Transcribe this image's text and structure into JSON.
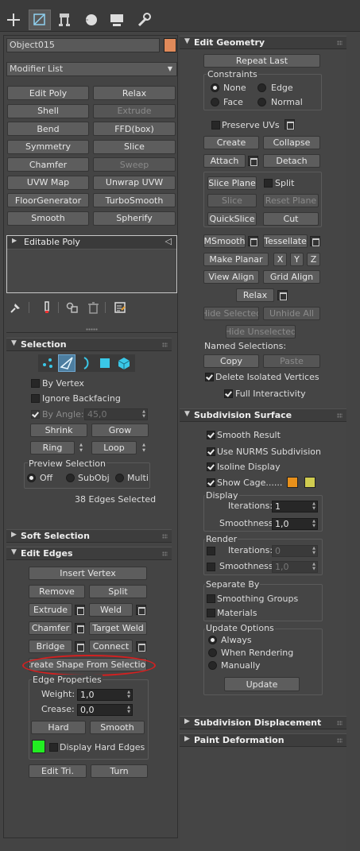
{
  "tabs": [
    {
      "name": "create-tab-icon"
    },
    {
      "name": "modify-tab-icon"
    },
    {
      "name": "hierarchy-tab-icon"
    },
    {
      "name": "motion-tab-icon"
    },
    {
      "name": "display-tab-icon"
    },
    {
      "name": "utilities-tab-icon"
    }
  ],
  "object_name": "Object015",
  "object_color": "#e08a5a",
  "modifier_list": "Modifier List",
  "modifier_buttons": [
    "Edit Poly",
    "Relax",
    "Shell",
    "Extrude",
    "Bend",
    "FFD(box)",
    "Symmetry",
    "Slice",
    "Chamfer",
    "Sweep",
    "UVW Map",
    "Unwrap UVW",
    "FloorGenerator",
    "TurboSmooth",
    "Smooth",
    "Spherify"
  ],
  "stack_item": "Editable Poly",
  "selection": {
    "title": "Selection",
    "by_vertex": "By Vertex",
    "ignore_backfacing": "Ignore Backfacing",
    "by_angle": "By Angle:",
    "angle_value": "45,0",
    "shrink": "Shrink",
    "grow": "Grow",
    "ring": "Ring",
    "loop": "Loop",
    "preview_title": "Preview Selection",
    "preview_off": "Off",
    "preview_subobj": "SubObj",
    "preview_multi": "Multi",
    "status": "38 Edges Selected"
  },
  "soft_selection": {
    "title": "Soft Selection"
  },
  "edit_edges": {
    "title": "Edit Edges",
    "insert_vertex": "Insert Vertex",
    "remove": "Remove",
    "split": "Split",
    "extrude": "Extrude",
    "weld": "Weld",
    "chamfer": "Chamfer",
    "target_weld": "Target Weld",
    "bridge": "Bridge",
    "connect": "Connect",
    "create_shape": "Create Shape From Selection",
    "edge_props": "Edge Properties",
    "weight_label": "Weight:",
    "weight_value": "1,0",
    "crease_label": "Crease:",
    "crease_value": "0,0",
    "hard": "Hard",
    "smooth": "Smooth",
    "hard_edge_color": "#22ee22",
    "display_hard_edges": "Display Hard Edges",
    "edit_tri": "Edit Tri.",
    "turn": "Turn"
  },
  "edit_geometry": {
    "title": "Edit Geometry",
    "repeat_last": "Repeat Last",
    "constraints": "Constraints",
    "none": "None",
    "edge": "Edge",
    "face": "Face",
    "normal": "Normal",
    "preserve_uvs": "Preserve UVs",
    "create": "Create",
    "collapse": "Collapse",
    "attach": "Attach",
    "detach": "Detach",
    "slice_plane": "Slice Plane",
    "split": "Split",
    "slice": "Slice",
    "reset_plane": "Reset Plane",
    "quickslice": "QuickSlice",
    "cut": "Cut",
    "msmooth": "MSmooth",
    "tessellate": "Tessellate",
    "make_planar": "Make Planar",
    "x": "X",
    "y": "Y",
    "z": "Z",
    "view_align": "View Align",
    "grid_align": "Grid Align",
    "relax": "Relax",
    "hide_selected": "Hide Selected",
    "unhide_all": "Unhide All",
    "hide_unselected": "Hide Unselected",
    "named_selections": "Named Selections:",
    "copy": "Copy",
    "paste": "Paste",
    "delete_isolated": "Delete Isolated Vertices",
    "full_interactivity": "Full Interactivity"
  },
  "subdivision_surface": {
    "title": "Subdivision Surface",
    "smooth_result": "Smooth Result",
    "use_nurms": "Use NURMS Subdivision",
    "isoline": "Isoline Display",
    "show_cage": "Show Cage......",
    "cage_color1": "#e8901a",
    "cage_color2": "#d0cc50",
    "display": "Display",
    "iterations_label": "Iterations:",
    "iterations_value": "1",
    "smoothness_label": "Smoothness:",
    "smoothness_value": "1,0",
    "render": "Render",
    "render_iterations_value": "0",
    "render_smoothness_value": "1,0",
    "separate_by": "Separate By",
    "smoothing_groups": "Smoothing Groups",
    "materials": "Materials",
    "update_options": "Update Options",
    "always": "Always",
    "when_rendering": "When Rendering",
    "manually": "Manually",
    "update": "Update"
  },
  "subdivision_displacement": {
    "title": "Subdivision Displacement"
  },
  "paint_deformation": {
    "title": "Paint Deformation"
  },
  "annotation_color": "#d42020"
}
